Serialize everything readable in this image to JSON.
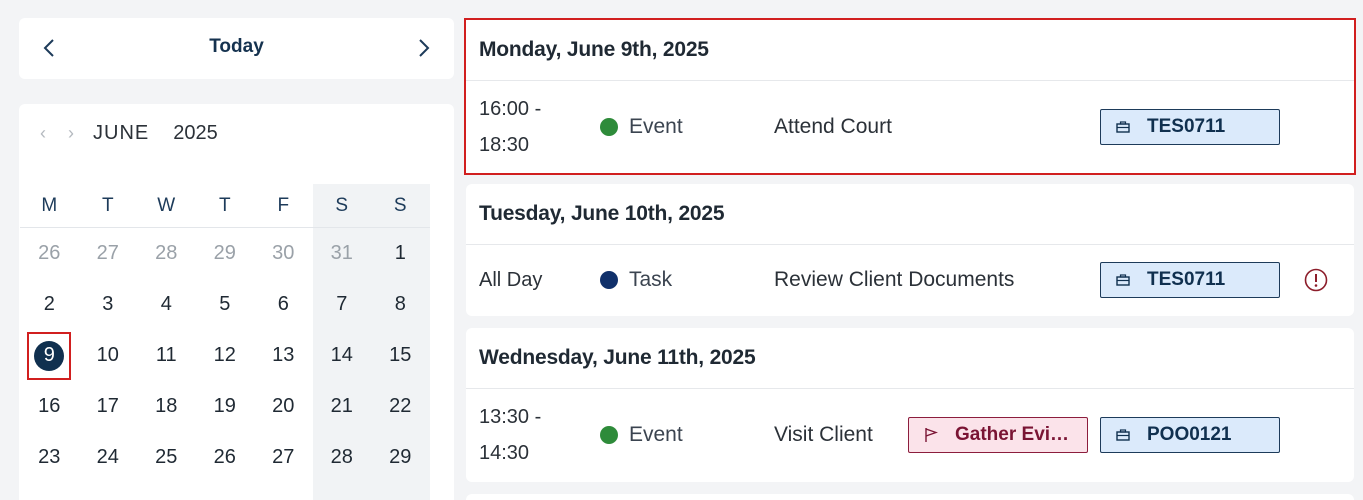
{
  "nav": {
    "prev_icon": "chevron-left-icon",
    "today_label": "Today",
    "next_icon": "chevron-right-icon"
  },
  "mini_calendar": {
    "month": "JUNE",
    "year": "2025",
    "weekdays": [
      "M",
      "T",
      "W",
      "T",
      "F",
      "S",
      "S"
    ],
    "weeks": [
      [
        {
          "d": "26",
          "muted": true
        },
        {
          "d": "27",
          "muted": true
        },
        {
          "d": "28",
          "muted": true
        },
        {
          "d": "29",
          "muted": true
        },
        {
          "d": "30",
          "muted": true
        },
        {
          "d": "31",
          "muted": true
        },
        {
          "d": "1"
        }
      ],
      [
        {
          "d": "2"
        },
        {
          "d": "3"
        },
        {
          "d": "4"
        },
        {
          "d": "5"
        },
        {
          "d": "6"
        },
        {
          "d": "7"
        },
        {
          "d": "8"
        }
      ],
      [
        {
          "d": "9",
          "selected": true
        },
        {
          "d": "10"
        },
        {
          "d": "11"
        },
        {
          "d": "12"
        },
        {
          "d": "13"
        },
        {
          "d": "14"
        },
        {
          "d": "15"
        }
      ],
      [
        {
          "d": "16"
        },
        {
          "d": "17"
        },
        {
          "d": "18"
        },
        {
          "d": "19"
        },
        {
          "d": "20"
        },
        {
          "d": "21"
        },
        {
          "d": "22"
        }
      ],
      [
        {
          "d": "23"
        },
        {
          "d": "24"
        },
        {
          "d": "25"
        },
        {
          "d": "26"
        },
        {
          "d": "27"
        },
        {
          "d": "28"
        },
        {
          "d": "29"
        }
      ]
    ]
  },
  "agenda": {
    "colors": {
      "event": "#2e8b3a",
      "task": "#10306a"
    },
    "days": [
      {
        "header": "Monday, June 9th, 2025",
        "item": {
          "time_start": "16:00 -",
          "time_end": "18:30",
          "type": "Event",
          "title": "Attend Court",
          "case_tag": "TES0711"
        }
      },
      {
        "header": "Tuesday, June 10th, 2025",
        "item": {
          "time_start": "All Day",
          "type": "Task",
          "title": "Review Client Documents",
          "case_tag": "TES0711",
          "alert_icon": "alert-circle-icon"
        }
      },
      {
        "header": "Wednesday, June 11th, 2025",
        "item": {
          "time_start": "13:30 -",
          "time_end": "14:30",
          "type": "Event",
          "title": "Visit Client",
          "task_tag": "Gather Evi…",
          "case_tag": "POO0121"
        }
      }
    ]
  }
}
